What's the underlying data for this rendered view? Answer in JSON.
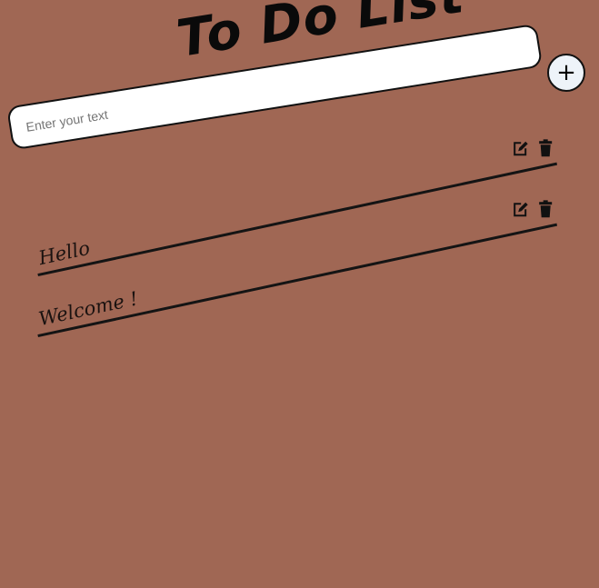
{
  "header": {
    "title": "To Do List"
  },
  "new_task": {
    "placeholder": "Enter your text",
    "value": "",
    "add_label": "+"
  },
  "tasks": [
    {
      "text": "Hello",
      "edit_icon": "edit-icon",
      "delete_icon": "trash-icon"
    },
    {
      "text": "Welcome !",
      "edit_icon": "edit-icon",
      "delete_icon": "trash-icon"
    }
  ],
  "colors": {
    "background": "#a06754",
    "input_background": "#ffffff",
    "add_button_background": "#eef3f9",
    "ink": "#111111"
  }
}
